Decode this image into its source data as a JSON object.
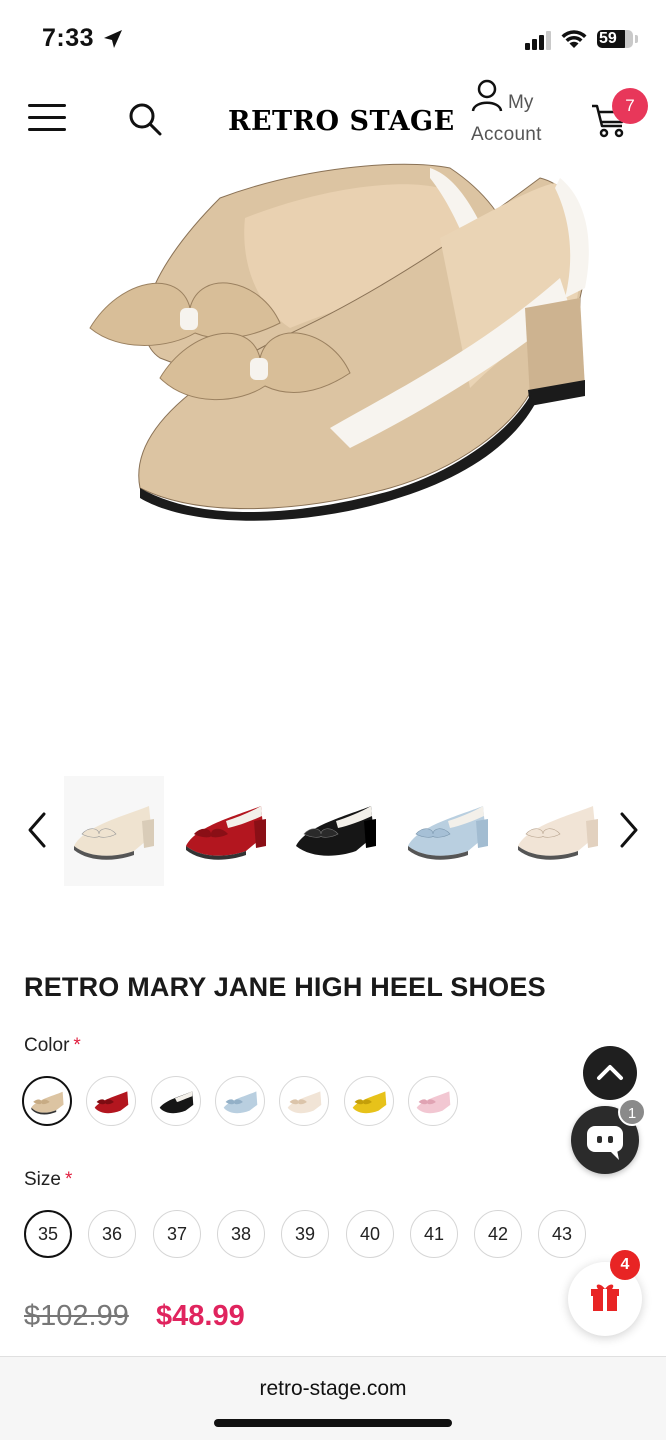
{
  "status_bar": {
    "time": "7:33",
    "battery": "59"
  },
  "header": {
    "brand": "RETRO STAGE",
    "account_my": "My",
    "account_label": "Account",
    "cart_count": "7"
  },
  "product": {
    "title": "RETRO MARY JANE HIGH HEEL SHOES",
    "color_label": "Color",
    "size_label": "Size",
    "required_mark": "*",
    "sizes": [
      "35",
      "36",
      "37",
      "38",
      "39",
      "40",
      "41",
      "42",
      "43"
    ],
    "selected_size": "35",
    "price_old": "$102.99",
    "price_new": "$48.99",
    "thumbnail_colors": [
      "#efe3d0",
      "#b3161f",
      "#161616",
      "#b9cfe0",
      "#f1e4d6"
    ],
    "swatch_colors": [
      "#dcc4a2",
      "#b3161f",
      "#161616",
      "#b9cfe0",
      "#f1e4d6",
      "#e7c21a",
      "#f2c7d2"
    ]
  },
  "floating": {
    "chat_count": "1",
    "gift_count": "4"
  },
  "browser": {
    "url": "retro-stage.com"
  },
  "colors": {
    "accent": "#e0245e",
    "badge": "#e8375a"
  }
}
